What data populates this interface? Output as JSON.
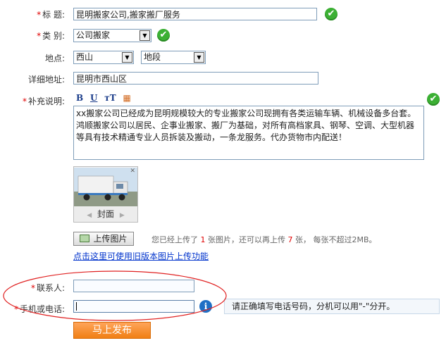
{
  "form": {
    "title": {
      "label": "标  题:",
      "value": "昆明搬家公司,搬家搬厂服务"
    },
    "category": {
      "label": "类  别:",
      "value": "公司搬家"
    },
    "location": {
      "label": "地点:",
      "district": "西山",
      "segment": "地段"
    },
    "address": {
      "label": "详细地址:",
      "value": "昆明市西山区"
    },
    "description": {
      "label": "补充说明:",
      "toolbar": [
        "B",
        "U",
        "тT",
        "▦"
      ],
      "text": "xx搬家公司已经成为昆明规模较大的专业搬家公司现拥有各类运输车辆、机械设备多台套。鸿顺搬家公司以居民、企事业搬家、搬厂为基础，对所有高档家具、钢琴、空调、大型机器等具有技术精通专业人员拆装及搬动，一条龙服务。代办货物市内配送！"
    },
    "image": {
      "caption": "封面",
      "prev": "◀",
      "next": "▶",
      "close": "✕"
    },
    "upload": {
      "button_label": "上传图片",
      "info_prefix": "您已经上传了",
      "uploaded_count": "1",
      "info_mid": "张图片，还可以再上传",
      "remaining_count": "7",
      "info_suffix": "张，  每张不超过2MB。",
      "legacy_link": "点击这里可使用旧版本图片上传功能"
    },
    "contact": {
      "label": "联系人:",
      "value": ""
    },
    "phone": {
      "label": "手机或电话:",
      "value": "",
      "hint": "请正确填写电话号码，分机可以用\"-\"分开。"
    },
    "submit_label": "马上发布"
  },
  "required_mark": "*",
  "check_mark": "✔",
  "info_icon": "i",
  "colors": {
    "required": "#e00000",
    "ok": "#3cb034",
    "submit": "#f07f14",
    "annotation": "#e02020",
    "link": "#0033cc"
  }
}
